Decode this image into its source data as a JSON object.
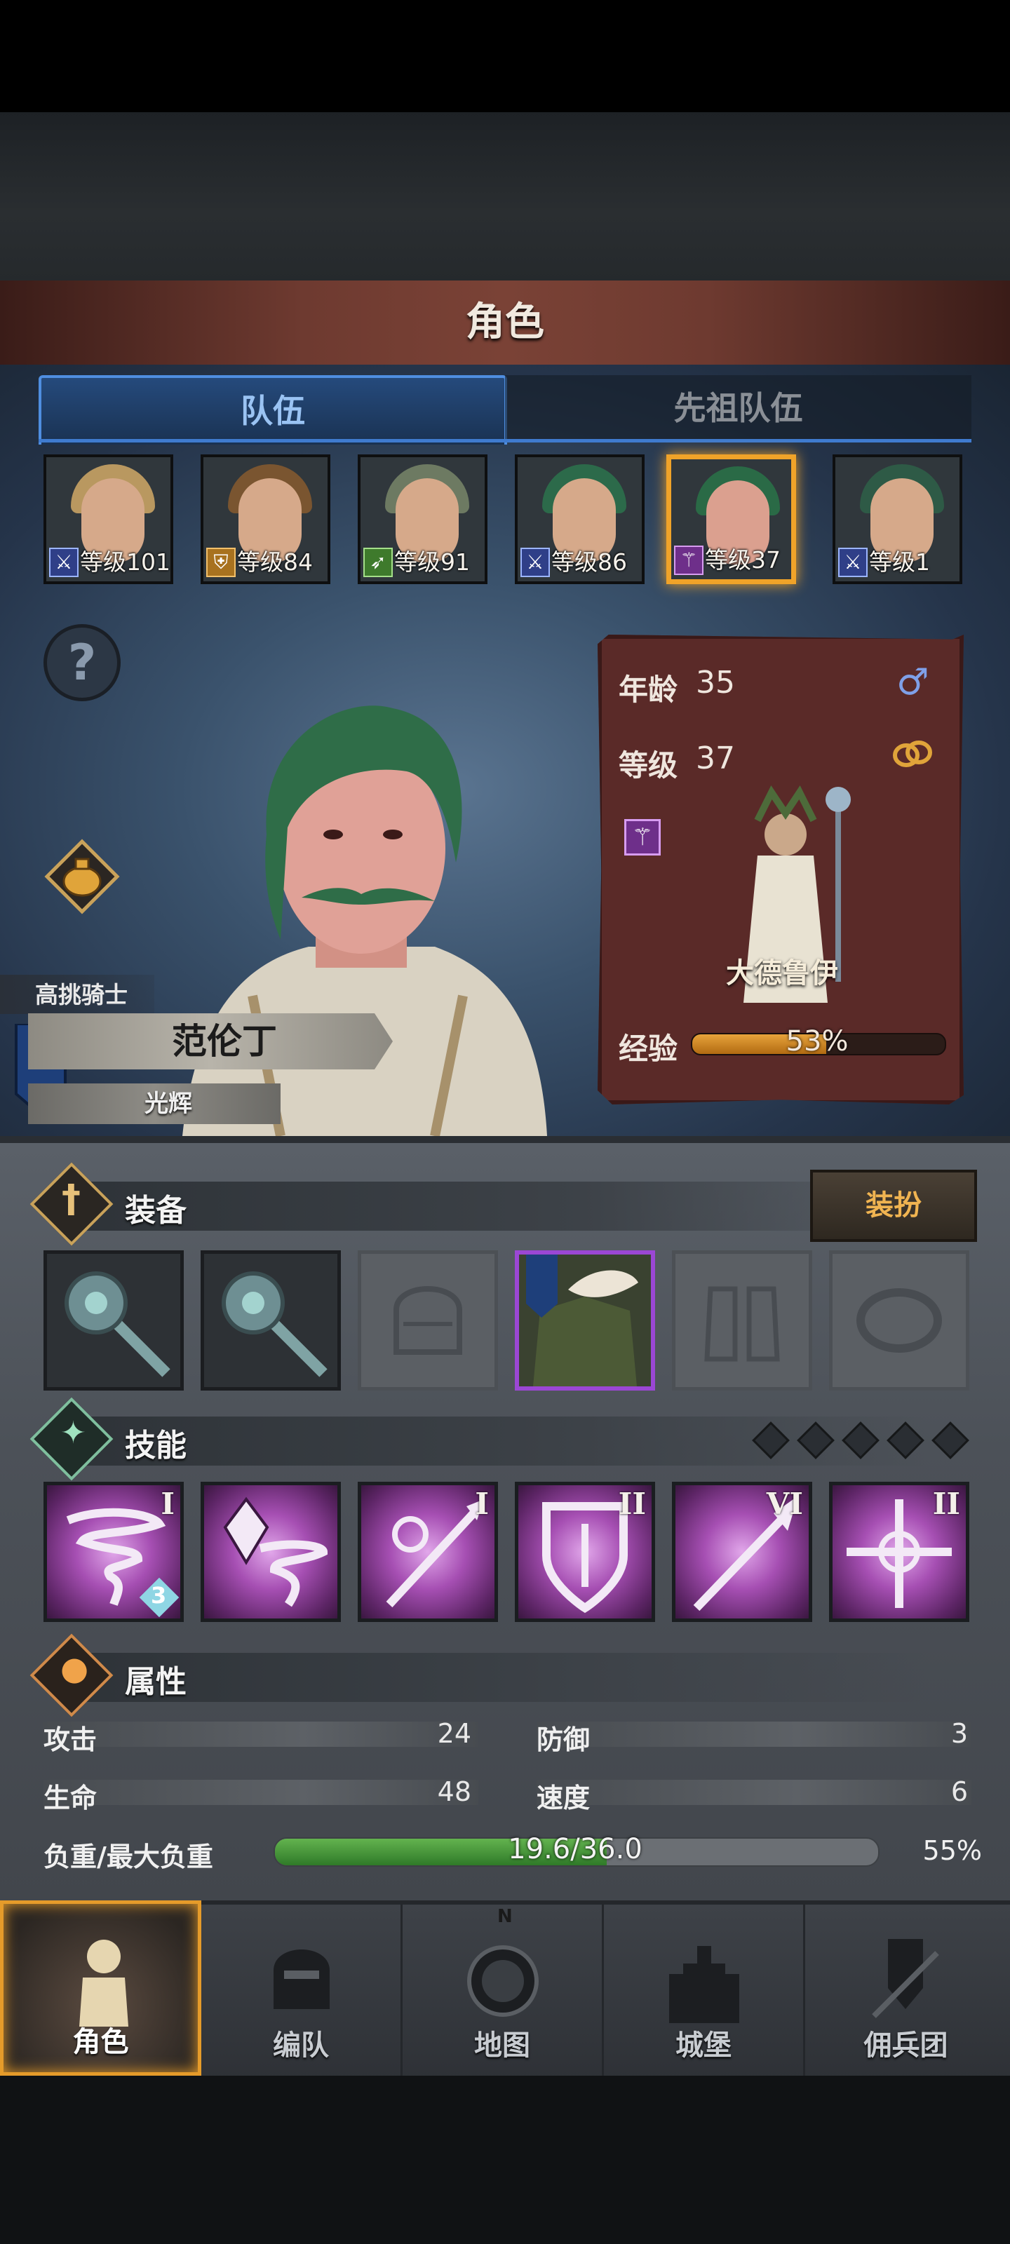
{
  "header": {
    "title": "角色"
  },
  "tabs": [
    {
      "label": "队伍",
      "active": true
    },
    {
      "label": "先祖队伍",
      "active": false
    }
  ],
  "party": [
    {
      "level_text": "等级101",
      "hair": "#b99860",
      "badge": "sword",
      "selected": false
    },
    {
      "level_text": "等级84",
      "hair": "#7a5530",
      "badge": "shield",
      "selected": false
    },
    {
      "level_text": "等级91",
      "hair": "#6d7a62",
      "badge": "bow",
      "selected": false
    },
    {
      "level_text": "等级86",
      "hair": "#2c6a4a",
      "badge": "sword",
      "selected": false
    },
    {
      "level_text": "等级37",
      "hair": "#2a6a46",
      "badge": "staff",
      "selected": true
    },
    {
      "level_text": "等级1",
      "hair": "#2e5a46",
      "badge": "sword",
      "selected": false
    }
  ],
  "hero": {
    "class_label": "高挑骑士",
    "name": "范伦丁",
    "title": "光辉"
  },
  "info": {
    "age_label": "年龄",
    "age": "35",
    "level_label": "等级",
    "level": "37",
    "class_name": "大德鲁伊",
    "exp_label": "经验",
    "exp_text": "53%",
    "exp_fraction": 0.53
  },
  "equipment": {
    "title": "装备",
    "outfit_button": "装扮",
    "slots": [
      "mace",
      "mace",
      "helmet-empty",
      "armor",
      "boots-empty",
      "ring-empty"
    ]
  },
  "skills": {
    "title": "技能",
    "points": 5,
    "items": [
      {
        "name": "tornado",
        "rank": "I",
        "badge": "3"
      },
      {
        "name": "crystal-tornado",
        "rank": ""
      },
      {
        "name": "holy-spear",
        "rank": "I"
      },
      {
        "name": "shield",
        "rank": "II"
      },
      {
        "name": "spear",
        "rank": "VI"
      },
      {
        "name": "holy-cross",
        "rank": "II"
      }
    ]
  },
  "attributes": {
    "title": "属性",
    "attack_label": "攻击",
    "attack": "24",
    "defense_label": "防御",
    "defense": "3",
    "health_label": "生命",
    "health": "48",
    "speed_label": "速度",
    "speed": "6",
    "weight_label": "负重/最大负重",
    "weight_text": "19.6/36.0",
    "weight_percent": "55%",
    "weight_fraction": 0.55
  },
  "nav": [
    {
      "label": "角色",
      "icon": "knight-icon",
      "active": true
    },
    {
      "label": "编队",
      "icon": "helmet-icon",
      "active": false
    },
    {
      "label": "地图",
      "icon": "compass-icon",
      "active": false,
      "compass_n": "N"
    },
    {
      "label": "城堡",
      "icon": "castle-icon",
      "active": false
    },
    {
      "label": "佣兵团",
      "icon": "mercenary-icon",
      "active": false
    }
  ],
  "colors": {
    "accent": "#f0a329",
    "tab_blue": "#4f8ee0",
    "skill_purple": "#a64fb3",
    "panel_red": "#5a2a28"
  }
}
